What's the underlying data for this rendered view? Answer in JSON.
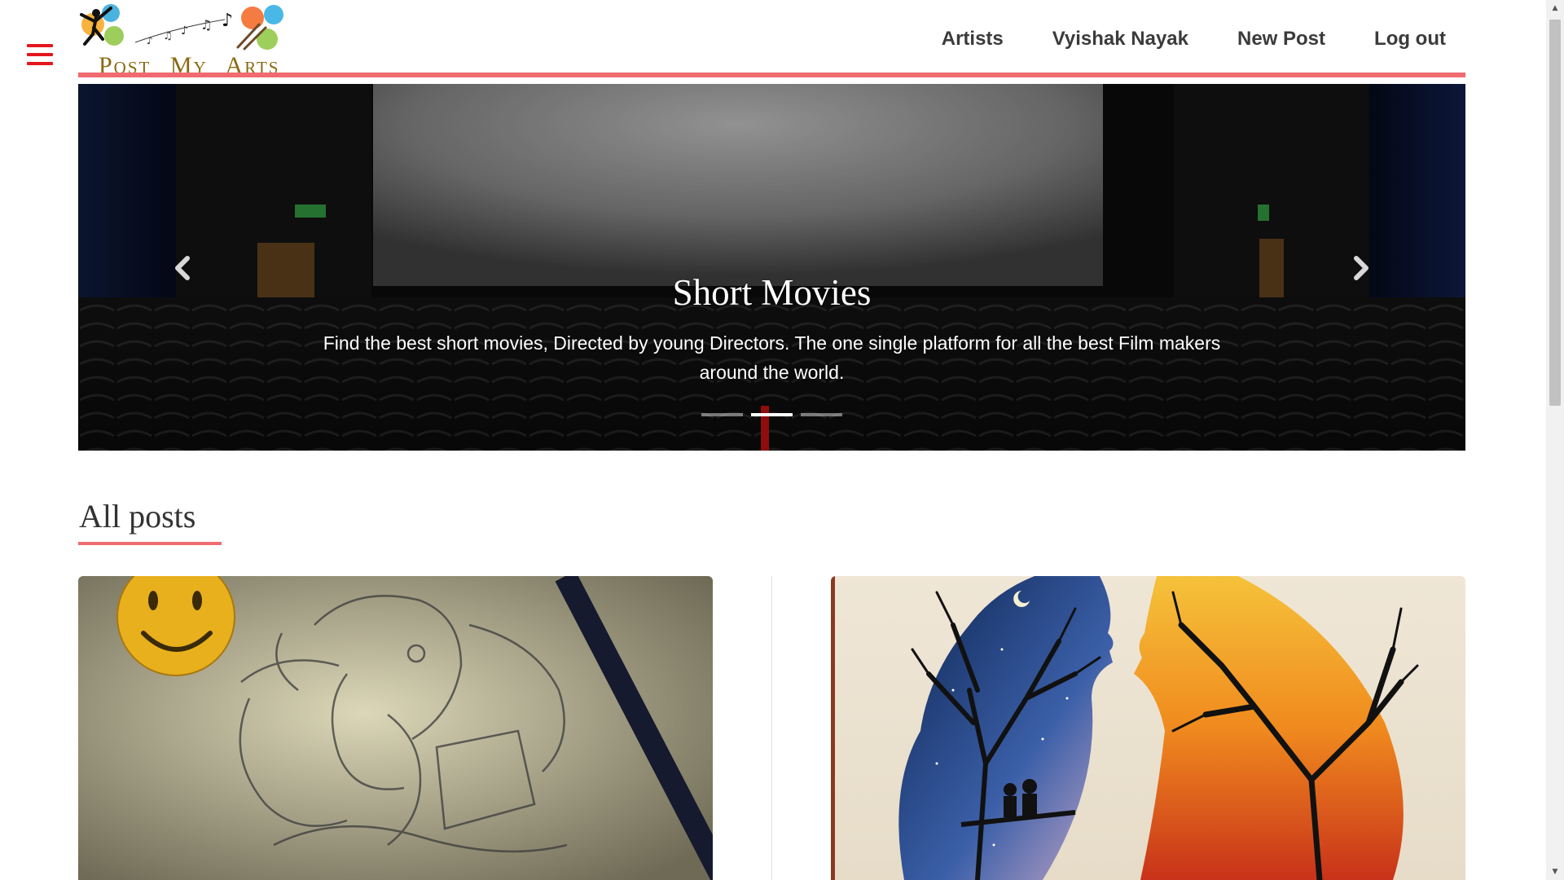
{
  "header": {
    "logo_text": "Post My Arts",
    "nav": [
      "Artists",
      "Vyishak Nayak",
      "New Post",
      "Log out"
    ]
  },
  "carousel": {
    "title": "Short Movies",
    "text": "Find the best short movies, Directed by young Directors. The one single platform for all the best Film makers around the world.",
    "slide_count": 3,
    "active_slide": 2
  },
  "main": {
    "section_title": "All posts"
  },
  "colors": {
    "accent": "#ef6b70",
    "menu_icon": "#e4171d",
    "nav_text": "#3b3b3b"
  },
  "icons": {
    "menu": "hamburger-menu-icon",
    "prev": "chevron-left-icon",
    "next": "chevron-right-icon"
  }
}
